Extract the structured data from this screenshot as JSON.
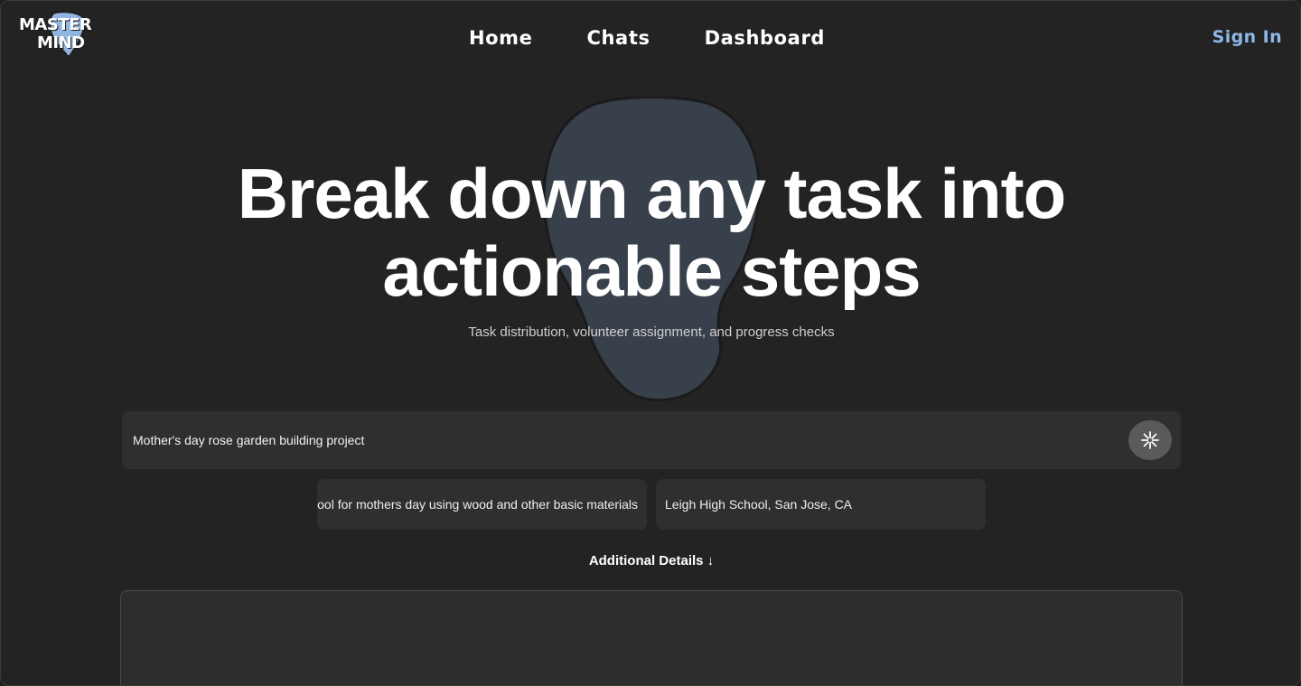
{
  "header": {
    "logo": {
      "line1": "MASTER",
      "line2": "MIND",
      "icon": "brain-drop-logo-icon",
      "accent": "#8fb5e0"
    },
    "nav": [
      {
        "label": "Home"
      },
      {
        "label": "Chats"
      },
      {
        "label": "Dashboard"
      }
    ],
    "sign_in": "Sign In",
    "sign_in_color": "#8eb8e6"
  },
  "hero": {
    "title_line1": "Break down any task into",
    "title_line2": "actionable steps",
    "subtitle": "Task distribution, volunteer assignment, and progress checks",
    "background_icon": "head-silhouette-icon",
    "shape_color": "#38404b"
  },
  "form": {
    "task_value": "Mother's day rose garden building project",
    "submit_icon": "sparkle-asterisk-icon",
    "description_value": "Build a rose garden at the school for mothers day using wood and other basic materials",
    "location_value": "Leigh High School, San Jose, CA",
    "additional_details_label": "Additional Details ↓",
    "details_value": ""
  },
  "colors": {
    "background": "#232323",
    "field_background": "#2f2f2f",
    "button_background": "#5a5a5a"
  }
}
